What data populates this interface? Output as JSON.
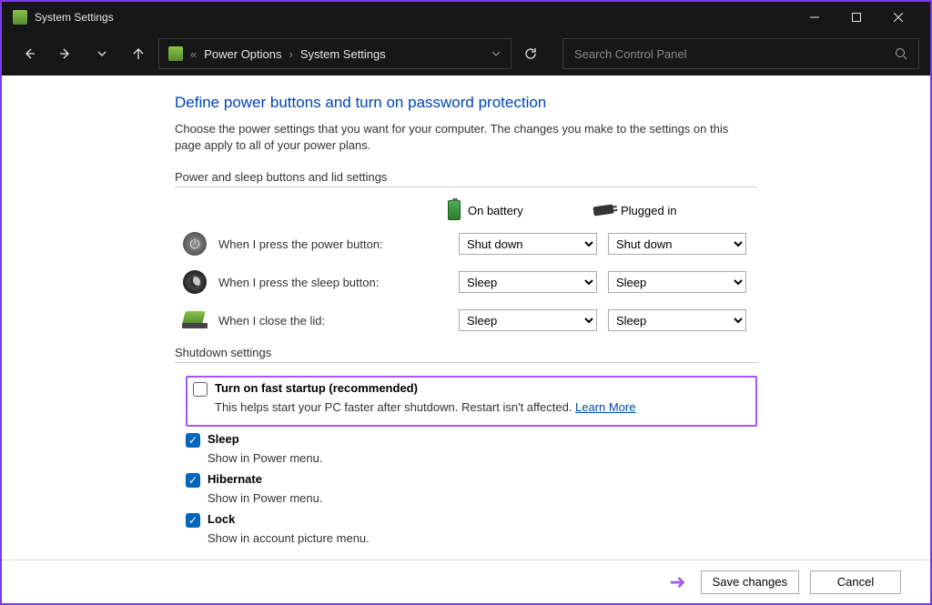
{
  "window": {
    "title": "System Settings"
  },
  "breadcrumb": {
    "item1": "Power Options",
    "item2": "System Settings"
  },
  "search": {
    "placeholder": "Search Control Panel"
  },
  "page": {
    "heading": "Define power buttons and turn on password protection",
    "description": "Choose the power settings that you want for your computer. The changes you make to the settings on this page apply to all of your power plans.",
    "section1": "Power and sleep buttons and lid settings",
    "col_battery": "On battery",
    "col_plugged": "Plugged in",
    "rows": {
      "power": {
        "label": "When I press the power button:",
        "battery": "Shut down",
        "plugged": "Shut down"
      },
      "sleep": {
        "label": "When I press the sleep button:",
        "battery": "Sleep",
        "plugged": "Sleep"
      },
      "lid": {
        "label": "When I close the lid:",
        "battery": "Sleep",
        "plugged": "Sleep"
      }
    },
    "section2": "Shutdown settings",
    "fast_startup": {
      "title": "Turn on fast startup (recommended)",
      "desc": "This helps start your PC faster after shutdown. Restart isn't affected. ",
      "link": "Learn More"
    },
    "options": {
      "sleep": {
        "title": "Sleep",
        "desc": "Show in Power menu."
      },
      "hibernate": {
        "title": "Hibernate",
        "desc": "Show in Power menu."
      },
      "lock": {
        "title": "Lock",
        "desc": "Show in account picture menu."
      }
    }
  },
  "footer": {
    "save": "Save changes",
    "cancel": "Cancel"
  }
}
